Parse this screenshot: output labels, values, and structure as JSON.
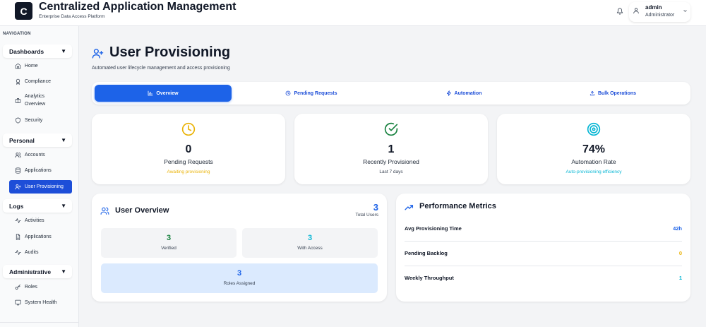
{
  "header": {
    "logo_letter": "C",
    "title": "Centralized Application Management",
    "subtitle": "Enterprise Data Access Platform",
    "user": {
      "name": "admin",
      "role": "Administrator"
    }
  },
  "sidebar": {
    "nav_label": "NAVIGATION",
    "groups": [
      {
        "label": "Dashboards",
        "items": [
          {
            "label": "Home",
            "icon": "home-icon"
          },
          {
            "label": "Compliance",
            "icon": "award-icon"
          },
          {
            "label_line1": "Analytics",
            "label_line2": "Overview",
            "icon": "briefcase-icon"
          },
          {
            "label": "Security",
            "icon": "shield-icon"
          }
        ]
      },
      {
        "label": "Personal",
        "items": [
          {
            "label": "Accounts",
            "icon": "users-icon"
          },
          {
            "label": "Applications",
            "icon": "database-icon"
          },
          {
            "label": "User Provisioning",
            "icon": "user-plus-icon",
            "active": true
          }
        ]
      },
      {
        "label": "Logs",
        "items": [
          {
            "label": "Activities",
            "icon": "activity-icon"
          },
          {
            "label": "Applications",
            "icon": "file-text-icon"
          },
          {
            "label": "Audits",
            "icon": "activity-icon"
          }
        ]
      },
      {
        "label": "Administrative",
        "items": [
          {
            "label": "Roles",
            "icon": "key-icon"
          },
          {
            "label": "System Health",
            "icon": "monitor-icon"
          }
        ]
      }
    ]
  },
  "page": {
    "title": "User Provisioning",
    "description": "Automated user lifecycle management and access provisioning"
  },
  "tabs": [
    {
      "label": "Overview",
      "icon": "bar-chart-icon",
      "active": true
    },
    {
      "label": "Pending Requests",
      "icon": "clock-icon"
    },
    {
      "label": "Automation",
      "icon": "zap-icon"
    },
    {
      "label": "Bulk Operations",
      "icon": "upload-icon"
    }
  ],
  "stats": [
    {
      "value": "0",
      "label": "Pending Requests",
      "sub": "Awaiting provisioning",
      "color": "#eab308",
      "icon": "clock-icon"
    },
    {
      "value": "1",
      "label": "Recently Provisioned",
      "sub": "Last 7 days",
      "color": "#15803d",
      "icon": "check-circle-icon"
    },
    {
      "value": "74%",
      "label": "Automation Rate",
      "sub": "Auto-provisioning efficiency",
      "color": "#06b6d4",
      "icon": "target-icon"
    }
  ],
  "user_overview": {
    "title": "User Overview",
    "total_value": "3",
    "total_label": "Total Users",
    "verified_value": "3",
    "verified_label": "Verified",
    "access_value": "3",
    "access_label": "With Access",
    "roles_value": "3",
    "roles_label": "Roles Assigned"
  },
  "performance": {
    "title": "Performance Metrics",
    "rows": [
      {
        "label": "Avg Provisioning Time",
        "value": "42h",
        "color": "#1d63e8"
      },
      {
        "label": "Pending Backlog",
        "value": "0",
        "color": "#eab308"
      },
      {
        "label": "Weekly Throughput",
        "value": "1",
        "color": "#06b6d4"
      }
    ]
  },
  "colors": {
    "accent": "#1d63e8",
    "sidebar_active": "#1d4ed8",
    "green": "#15803d",
    "cyan": "#06b6d4",
    "yellow": "#eab308"
  }
}
